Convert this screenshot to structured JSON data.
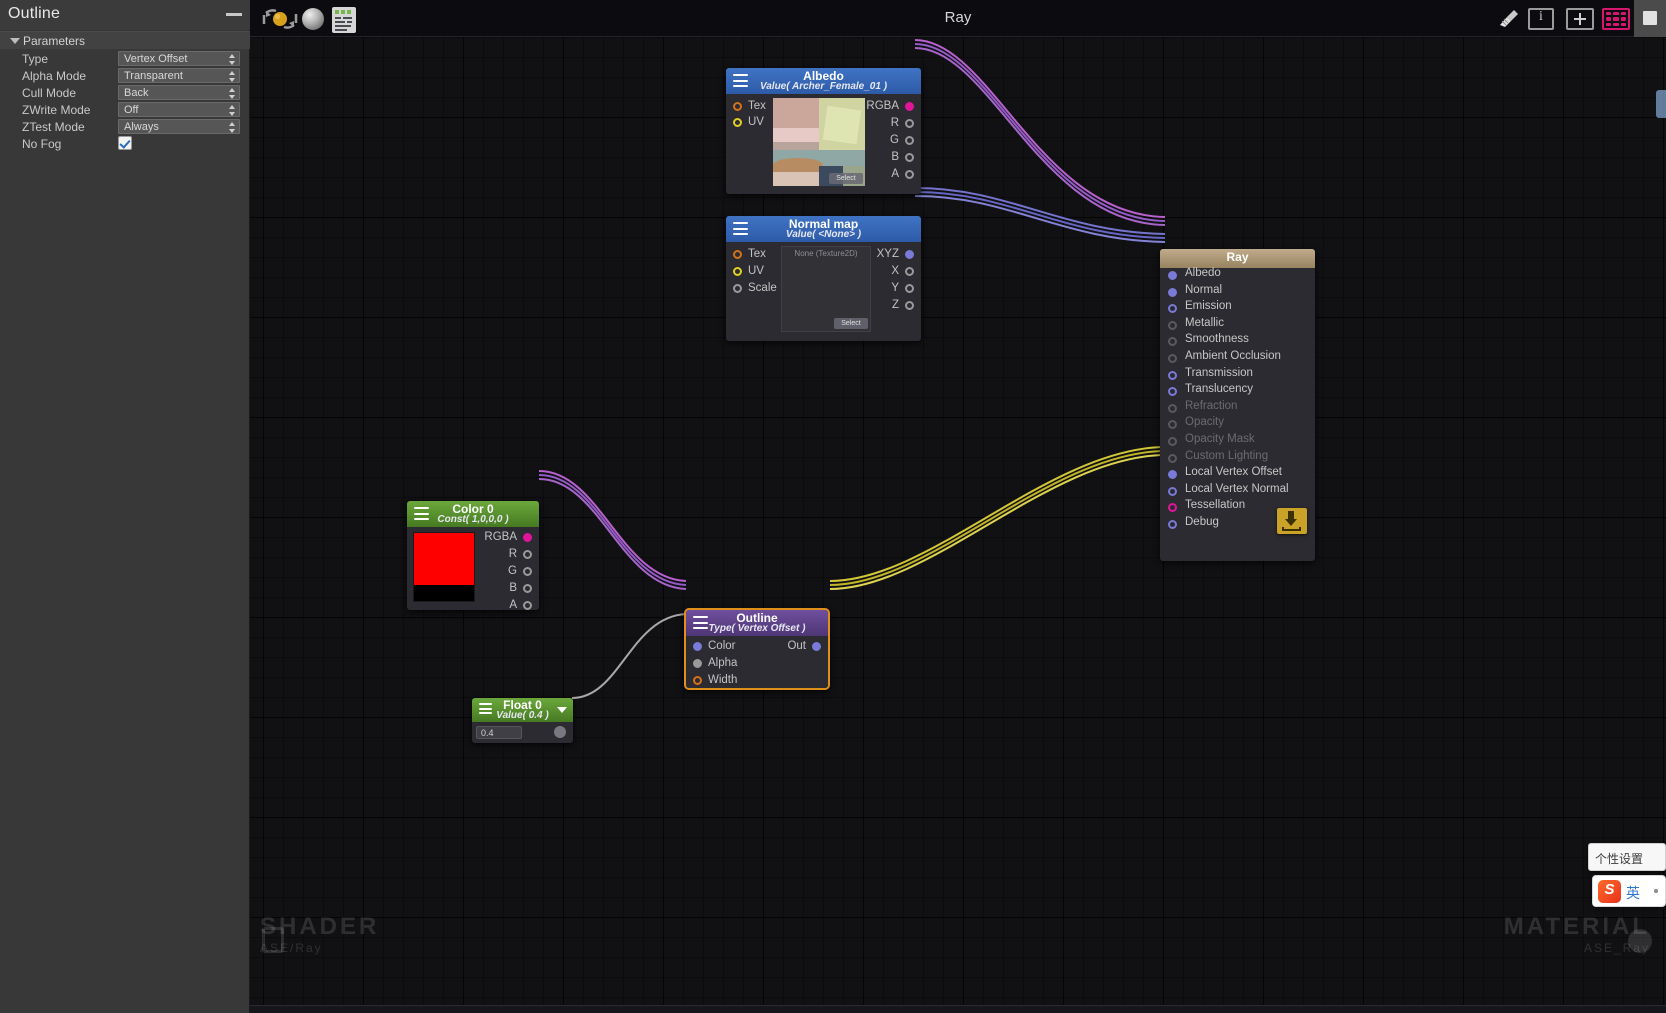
{
  "panel": {
    "title": "Outline",
    "minimize_icon": "minimize-icon",
    "section_label": "Parameters",
    "rows": [
      {
        "label": "Type",
        "value": "Vertex Offset",
        "control": "dropdown"
      },
      {
        "label": "Alpha Mode",
        "value": "Transparent",
        "control": "dropdown"
      },
      {
        "label": "Cull Mode",
        "value": "Back",
        "control": "dropdown"
      },
      {
        "label": "ZWrite Mode",
        "value": "Off",
        "control": "dropdown"
      },
      {
        "label": "ZTest Mode",
        "value": "Always",
        "control": "dropdown"
      },
      {
        "label": "No Fog",
        "value": "checked",
        "control": "checkbox"
      }
    ]
  },
  "toolbar": {
    "title": "Ray",
    "left_icons": [
      {
        "name": "update-shader-icon",
        "glyph": "refresh-sphere"
      },
      {
        "name": "preview-sphere-icon",
        "glyph": "sphere"
      },
      {
        "name": "open-code-icon",
        "glyph": "document"
      }
    ],
    "right_icons": [
      {
        "name": "cleanup-broom-icon",
        "glyph": "broom"
      },
      {
        "name": "info-icon",
        "glyph": "i"
      },
      {
        "name": "add-node-icon",
        "glyph": "plus"
      },
      {
        "name": "grid-toggle-icon",
        "glyph": "dots-grid",
        "color": "#d5176f"
      },
      {
        "name": "stop-live-preview-icon",
        "glyph": "square"
      }
    ]
  },
  "nodes": {
    "albedo": {
      "title": "Albedo",
      "subtitle": "Value( Archer_Female_01 )",
      "inputs": [
        {
          "label": "Tex",
          "color": "#d4721a",
          "filled": false
        },
        {
          "label": "UV",
          "color": "#e0d024",
          "filled": false
        }
      ],
      "outputs": [
        {
          "label": "RGBA",
          "color": "#e1149a",
          "filled": true
        },
        {
          "label": "R",
          "color": "#9a9a9a",
          "filled": false
        },
        {
          "label": "G",
          "color": "#9a9a9a",
          "filled": false
        },
        {
          "label": "B",
          "color": "#9a9a9a",
          "filled": false
        },
        {
          "label": "A",
          "color": "#9a9a9a",
          "filled": false
        }
      ],
      "select_button": "Select"
    },
    "normal": {
      "title": "Normal map",
      "subtitle": "Value( <None> )",
      "thumb_placeholder": "None (Texture2D)",
      "inputs": [
        {
          "label": "Tex",
          "color": "#d4721a",
          "filled": false
        },
        {
          "label": "UV",
          "color": "#e0d024",
          "filled": false
        },
        {
          "label": "Scale",
          "color": "#9a9a9a",
          "filled": false
        }
      ],
      "outputs": [
        {
          "label": "XYZ",
          "color": "#7a7ad8",
          "filled": true
        },
        {
          "label": "X",
          "color": "#9a9a9a",
          "filled": false
        },
        {
          "label": "Y",
          "color": "#9a9a9a",
          "filled": false
        },
        {
          "label": "Z",
          "color": "#9a9a9a",
          "filled": false
        }
      ],
      "select_button": "Select"
    },
    "color0": {
      "title": "Color 0",
      "subtitle": "Const( 1,0,0,0 )",
      "swatch_color": "#ff0000",
      "outputs": [
        {
          "label": "RGBA",
          "color": "#e1149a",
          "filled": true
        },
        {
          "label": "R",
          "color": "#9a9a9a",
          "filled": false
        },
        {
          "label": "G",
          "color": "#9a9a9a",
          "filled": false
        },
        {
          "label": "B",
          "color": "#9a9a9a",
          "filled": false
        },
        {
          "label": "A",
          "color": "#9a9a9a",
          "filled": false
        }
      ]
    },
    "outline": {
      "title": "Outline",
      "subtitle": "Type( Vertex Offset )",
      "selected": true,
      "inputs": [
        {
          "label": "Color",
          "color": "#7a7ad8",
          "filled": true
        },
        {
          "label": "Alpha",
          "color": "#9a9a9a",
          "filled": true
        },
        {
          "label": "Width",
          "color": "#d4721a",
          "filled": false
        }
      ],
      "outputs": [
        {
          "label": "Out",
          "color": "#7a7ad8",
          "filled": true
        }
      ]
    },
    "float0": {
      "title": "Float 0",
      "subtitle": "Value( 0.4 )",
      "field_value": "0.4",
      "caret_icon": "chevron-down-icon"
    },
    "ray": {
      "title": "Ray",
      "ports": [
        {
          "label": "Albedo",
          "filled": true,
          "dim": false,
          "color": "#7a7ad8"
        },
        {
          "label": "Normal",
          "filled": true,
          "dim": false,
          "color": "#7a7ad8"
        },
        {
          "label": "Emission",
          "filled": false,
          "dim": false,
          "color": "#7a7ad8"
        },
        {
          "label": "Metallic",
          "filled": false,
          "dim": true,
          "color": "#5a5a5e"
        },
        {
          "label": "Smoothness",
          "filled": false,
          "dim": true,
          "color": "#5a5a5e"
        },
        {
          "label": "Ambient Occlusion",
          "filled": false,
          "dim": true,
          "color": "#5a5a5e"
        },
        {
          "label": "Transmission",
          "filled": false,
          "dim": false,
          "color": "#7a7ad8"
        },
        {
          "label": "Translucency",
          "filled": false,
          "dim": false,
          "color": "#7a7ad8"
        },
        {
          "label": "Refraction",
          "filled": false,
          "dim": true,
          "color": "#4a4a4e"
        },
        {
          "label": "Opacity",
          "filled": false,
          "dim": true,
          "color": "#4a4a4e"
        },
        {
          "label": "Opacity Mask",
          "filled": false,
          "dim": true,
          "color": "#4a4a4e"
        },
        {
          "label": "Custom Lighting",
          "filled": false,
          "dim": true,
          "color": "#4a4a4e"
        },
        {
          "label": "Local Vertex Offset",
          "filled": true,
          "dim": false,
          "color": "#7a7ad8"
        },
        {
          "label": "Local Vertex Normal",
          "filled": false,
          "dim": false,
          "color": "#7a7ad8"
        },
        {
          "label": "Tessellation",
          "filled": false,
          "dim": false,
          "color": "#e1149a"
        },
        {
          "label": "Debug",
          "filled": false,
          "dim": false,
          "color": "#7a7ad8"
        }
      ],
      "save_icon": "save-download-icon"
    }
  },
  "watermarks": {
    "shader_title": "SHADER",
    "shader_path": "ASE/Ray",
    "material_title": "MATERIAL",
    "material_path": "ASE_Ray"
  },
  "ime": {
    "popup_text": "个性设置",
    "logo_letter": "S",
    "lang_label": "英"
  }
}
